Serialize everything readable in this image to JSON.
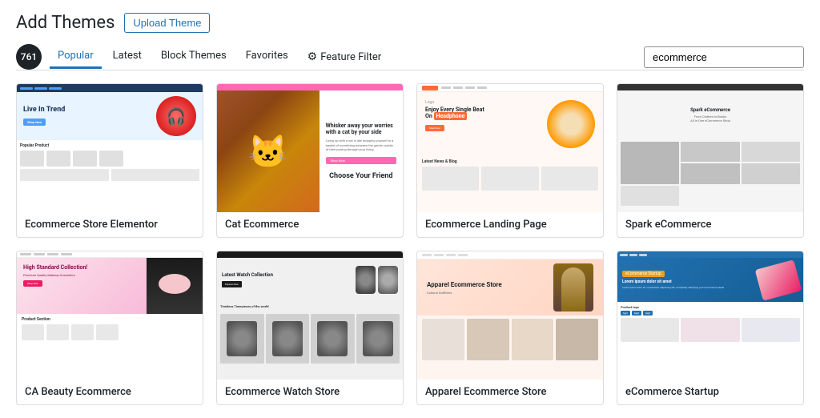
{
  "page": {
    "title": "Add Themes",
    "upload_button": "Upload Theme"
  },
  "filters": {
    "count": "761",
    "links": [
      {
        "id": "popular",
        "label": "Popular",
        "active": true
      },
      {
        "id": "latest",
        "label": "Latest",
        "active": false
      },
      {
        "id": "block-themes",
        "label": "Block Themes",
        "active": false
      },
      {
        "id": "favorites",
        "label": "Favorites",
        "active": false
      }
    ],
    "feature_filter": "Feature Filter",
    "search_placeholder": "ecommerce",
    "search_value": "ecommerce"
  },
  "themes": [
    {
      "id": "ecommerce-store-elementor",
      "name": "Ecommerce Store Elementor",
      "preview_type": "elementor"
    },
    {
      "id": "cat-ecommerce",
      "name": "Cat Ecommerce",
      "preview_type": "cat"
    },
    {
      "id": "ecommerce-landing-page",
      "name": "Ecommerce Landing Page",
      "preview_type": "landing"
    },
    {
      "id": "spark-ecommerce",
      "name": "Spark eCommerce",
      "preview_type": "spark"
    },
    {
      "id": "ca-beauty-ecommerce",
      "name": "CA Beauty Ecommerce",
      "preview_type": "beauty"
    },
    {
      "id": "ecommerce-watch-store",
      "name": "Ecommerce Watch Store",
      "preview_type": "watch"
    },
    {
      "id": "apparel-ecommerce-store",
      "name": "Apparel Ecommerce Store",
      "preview_type": "apparel"
    },
    {
      "id": "ecommerce-startup",
      "name": "eCommerce Startup",
      "preview_type": "startup"
    }
  ],
  "colors": {
    "primary": "#2271b1",
    "border": "#dcdcde",
    "text": "#1d2327"
  }
}
